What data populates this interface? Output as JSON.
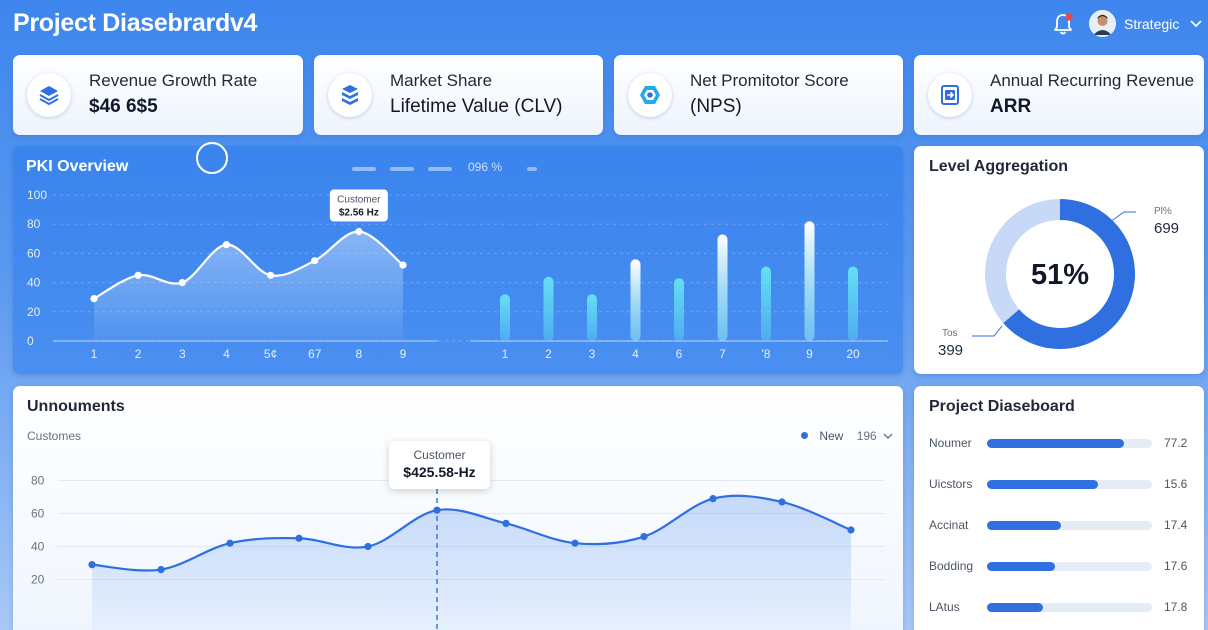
{
  "app": {
    "title": "Project Diasebrardv4"
  },
  "user": {
    "name": "Strategic",
    "icons": [
      "bell-icon",
      "avatar",
      "chevron-down-icon"
    ]
  },
  "kpis": [
    {
      "title": "Revenue Growth Rate",
      "value": "$46 6$5",
      "icon": "stack-layers-icon"
    },
    {
      "title": "Market Share",
      "value": "Lifetime Value (CLV)",
      "icon": "stack-cube-icon"
    },
    {
      "title": "Net Promitotor Score",
      "value": "(NPS)",
      "icon": "hexagon-icon"
    },
    {
      "title": "Annual Recurring Revenue",
      "value": "ARR",
      "icon": "square-arrow-icon"
    }
  ],
  "overview": {
    "title": "PKI Overview",
    "legend_pct": "096 %",
    "tooltip": {
      "label": "Customer",
      "value": "$2.56 Hz"
    }
  },
  "level": {
    "title": "Level Aggregation",
    "center_label": "51%",
    "callout_top": {
      "label": "Pl%",
      "value": "699"
    },
    "callout_bottom": {
      "label": "Tos",
      "value": "399"
    }
  },
  "bottom": {
    "title": "Unnouments",
    "sublabel": "Customes",
    "legend_new": "New",
    "legend_select": "196",
    "tooltip": {
      "label": "Customer",
      "value": "$425.58-Hz"
    }
  },
  "project": {
    "title": "Project Diaseboard",
    "rows": [
      {
        "label": "Noumer",
        "value": "77.2",
        "fill": 0.83
      },
      {
        "label": "Uicstors",
        "value": "15.6",
        "fill": 0.67
      },
      {
        "label": "Accinat",
        "value": "17.4",
        "fill": 0.45
      },
      {
        "label": "Bodding",
        "value": "17.6",
        "fill": 0.41
      },
      {
        "label": "LAtus",
        "value": "17.8",
        "fill": 0.34
      }
    ]
  },
  "colors": {
    "accent": "#2f6fe0",
    "panel_blue": "#3a84ee",
    "donut_light": "#c7d9f7"
  },
  "chart_data": [
    {
      "type": "area",
      "title": "PKI Overview",
      "categories": [
        "1",
        "2",
        "3",
        "4",
        "5¢",
        "67",
        "8",
        "9"
      ],
      "values": [
        29,
        45,
        40,
        66,
        45,
        55,
        75,
        52
      ],
      "yticks": [
        "100",
        "80",
        "60",
        "40",
        "20",
        "0"
      ],
      "ylim": [
        0,
        100
      ]
    },
    {
      "type": "bar",
      "categories": [
        "1",
        "2",
        "3",
        "4",
        "6",
        "7",
        "'8",
        "9",
        "20"
      ],
      "values": [
        32,
        44,
        32,
        56,
        43,
        73,
        51,
        82,
        51
      ],
      "ylim": [
        0,
        100
      ]
    },
    {
      "type": "pie",
      "title": "Level Aggregation",
      "slices": [
        {
          "label": "Pl%",
          "value": 699
        },
        {
          "label": "Tos",
          "value": 399
        }
      ],
      "center": "51%"
    },
    {
      "type": "line",
      "title": "Unnouments",
      "ylabel": "Customes",
      "series": [
        {
          "name": "New",
          "values": [
            29,
            26,
            42,
            45,
            40,
            62,
            54,
            42,
            46,
            69,
            67,
            50
          ]
        }
      ],
      "yticks": [
        "80",
        "60",
        "40",
        "20"
      ],
      "ylim": [
        10,
        90
      ]
    }
  ]
}
